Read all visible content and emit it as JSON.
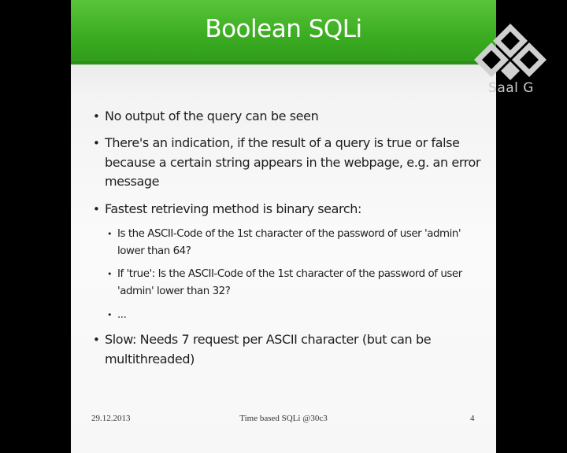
{
  "slide": {
    "title": "Boolean SQLi",
    "bullets": [
      {
        "lines": [
          "No output of the query can be seen"
        ]
      },
      {
        "lines": [
          "There's an indication, if the result of a query is true or false",
          "because a certain string appears in the webpage, e.g. an error",
          "message"
        ]
      },
      {
        "lines": [
          "Fastest retrieving method is binary search:"
        ]
      },
      {
        "lines": [
          "Slow: Needs 7 request per ASCII character (but can be",
          "multithreaded)"
        ]
      }
    ],
    "subbullets": [
      {
        "lines": [
          "Is the ASCII-Code of the 1st character of the password of user 'admin'",
          "lower than 64?"
        ]
      },
      {
        "lines": [
          "If 'true': Is the ASCII-Code of the 1st character of the password of user",
          "'admin' lower than 32?"
        ]
      },
      {
        "lines": [
          "..."
        ]
      }
    ],
    "bullet_glyph": "•"
  },
  "footer": {
    "date": "29.12.2013",
    "center": "Time based SQLi @30c3",
    "page": "4"
  },
  "logo": {
    "text": "Saal G",
    "color": "#c9c9c9"
  },
  "colors": {
    "header_green": "#3cad22",
    "background": "#000000",
    "slide_bg": "#f5f5f5"
  }
}
